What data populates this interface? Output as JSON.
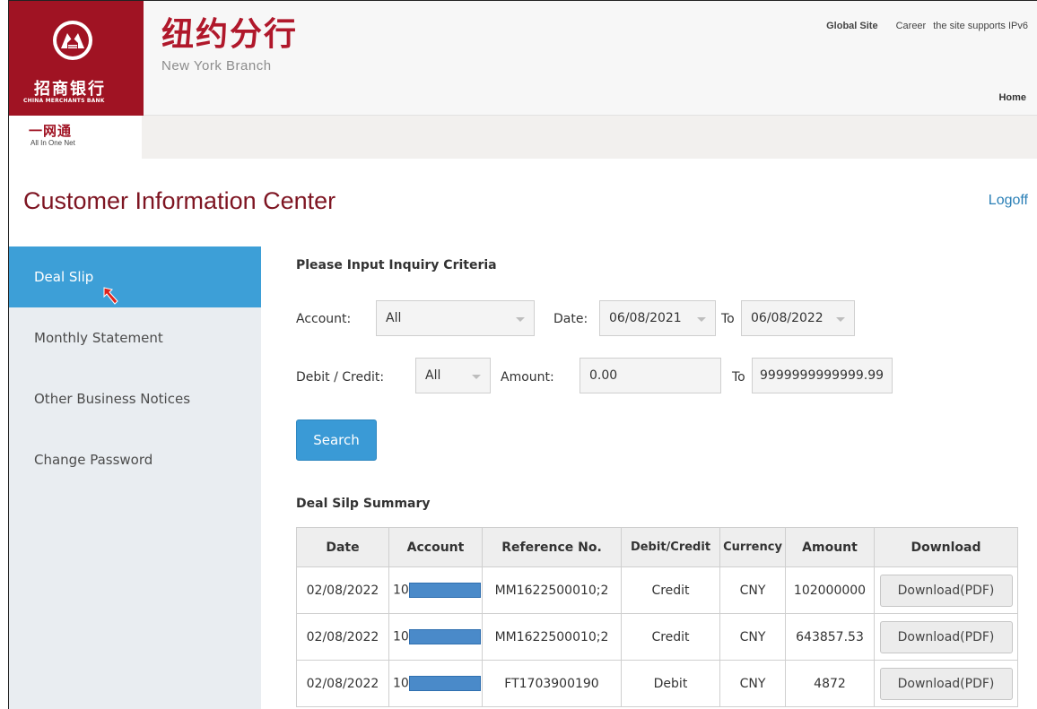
{
  "header": {
    "bank_cn": "招商银行",
    "bank_en": "CHINA MERCHANTS BANK",
    "branch_cn": "纽约分行",
    "branch_en": "New York Branch",
    "links": [
      "Global Site",
      "Career",
      "the site supports IPv6"
    ],
    "home": "Home",
    "brand_color": "#a01323"
  },
  "subheader": {
    "aion_cn": "一网通",
    "aion_en": "All In One Net"
  },
  "page": {
    "title": "Customer Information Center",
    "logoff": "Logoff"
  },
  "sidebar": {
    "items": [
      {
        "label": "Deal Slip",
        "active": true
      },
      {
        "label": "Monthly Statement",
        "active": false
      },
      {
        "label": "Other Business Notices",
        "active": false
      },
      {
        "label": "Change Password",
        "active": false
      }
    ],
    "accent_color": "#3d9fd7"
  },
  "criteria": {
    "title": "Please Input Inquiry Criteria",
    "account_label": "Account:",
    "account_value": "All",
    "date_label": "Date:",
    "date_from": "06/08/2021",
    "to_label": "To",
    "date_to": "06/08/2022",
    "dc_label": "Debit / Credit:",
    "dc_value": "All",
    "amount_label": "Amount:",
    "amount_from": "0.00",
    "amount_to": "9999999999999.99",
    "search_label": "Search"
  },
  "summary": {
    "title": "Deal Silp Summary",
    "columns": [
      "Date",
      "Account",
      "Reference No.",
      "Debit/Credit",
      "Currency",
      "Amount",
      "Download"
    ],
    "rows": [
      {
        "date": "02/08/2022",
        "account": "10",
        "ref": "MM1622500010;2",
        "dc": "Credit",
        "currency": "CNY",
        "amount": "102000000",
        "download": "Download(PDF)"
      },
      {
        "date": "02/08/2022",
        "account": "10",
        "ref": "MM1622500010;2",
        "dc": "Credit",
        "currency": "CNY",
        "amount": "643857.53",
        "download": "Download(PDF)"
      },
      {
        "date": "02/08/2022",
        "account": "10",
        "ref": "FT1703900190",
        "dc": "Debit",
        "currency": "CNY",
        "amount": "4872",
        "download": "Download(PDF)"
      }
    ]
  }
}
